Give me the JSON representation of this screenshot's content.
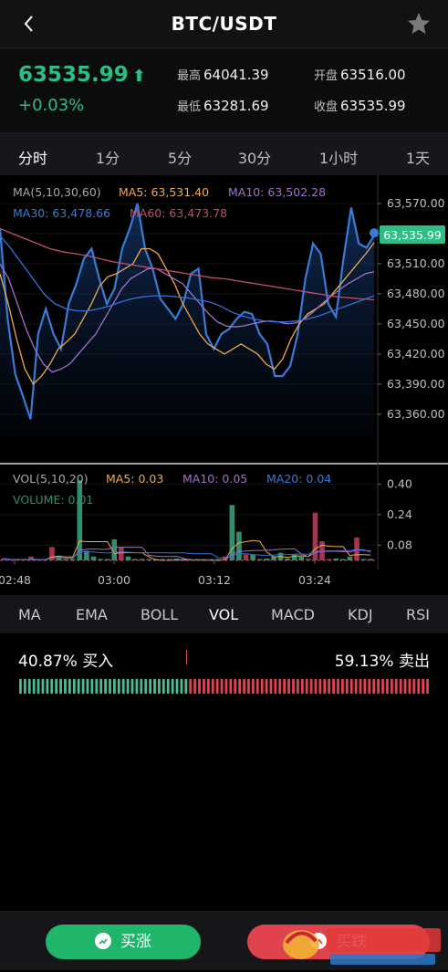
{
  "header": {
    "title": "BTC/USDT",
    "back_icon": "chevron-left-icon",
    "favorite_icon": "star-icon"
  },
  "ticker": {
    "price": "63535.99",
    "change": "+0.03%",
    "high_label": "最高",
    "high": "64041.39",
    "low_label": "最低",
    "low": "63281.69",
    "open_label": "开盘",
    "open": "63516.00",
    "close_label": "收盘",
    "close": "63535.99",
    "up_color": "#2ebd85"
  },
  "timeframes": [
    "分时",
    "1分",
    "5分",
    "30分",
    "1小时",
    "1天"
  ],
  "active_timeframe": "分时",
  "chart_data": {
    "type": "line",
    "main": {
      "legend_line1": {
        "ma": "MA(5,10,30,60)",
        "ma5": "MA5: 63,531.40",
        "ma10": "MA10: 63,502.28"
      },
      "legend_line2": {
        "ma30": "MA30: 63,478.66",
        "ma60": "MA60: 63,473.78"
      },
      "y_ticks": [
        "63,570.00",
        "63,540.00",
        "63,510.00",
        "63,480.00",
        "63,450.00",
        "63,420.00",
        "63,390.00",
        "63,360.00"
      ],
      "ylim": [
        63338,
        63580
      ],
      "last_price_label": "63,535.99",
      "series": [
        {
          "name": "price",
          "color": "#3a7bd5",
          "values": [
            63545,
            63455,
            63400,
            63378,
            63355,
            63440,
            63465,
            63440,
            63425,
            63470,
            63490,
            63515,
            63525,
            63495,
            63470,
            63485,
            63525,
            63545,
            63570,
            63525,
            63505,
            63475,
            63465,
            63455,
            63470,
            63500,
            63505,
            63440,
            63425,
            63440,
            63445,
            63455,
            63462,
            63460,
            63440,
            63430,
            63398,
            63398,
            63408,
            63440,
            63495,
            63530,
            63520,
            63470,
            63457,
            63515,
            63566,
            63530,
            63526,
            63538
          ]
        },
        {
          "name": "MA5",
          "color": "#f0a94b",
          "values": [
            63500,
            63470,
            63435,
            63405,
            63390,
            63398,
            63410,
            63425,
            63432,
            63440,
            63455,
            63470,
            63488,
            63497,
            63500,
            63505,
            63510,
            63525,
            63525,
            63520,
            63505,
            63490,
            63470,
            63455,
            63440,
            63430,
            63425,
            63420,
            63425,
            63430,
            63425,
            63420,
            63410,
            63405,
            63415,
            63435,
            63450,
            63460,
            63465,
            63470,
            63480,
            63490,
            63500,
            63510,
            63520,
            63531
          ]
        },
        {
          "name": "MA10",
          "color": "#a070c8",
          "values": [
            63510,
            63495,
            63470,
            63445,
            63425,
            63410,
            63402,
            63405,
            63410,
            63420,
            63430,
            63440,
            63455,
            63470,
            63485,
            63495,
            63500,
            63505,
            63505,
            63500,
            63495,
            63490,
            63480,
            63470,
            63460,
            63452,
            63448,
            63447,
            63448,
            63450,
            63452,
            63453,
            63452,
            63450,
            63451,
            63455,
            63462,
            63470,
            63477,
            63484,
            63490,
            63495,
            63500,
            63502
          ]
        },
        {
          "name": "MA30",
          "color": "#3a6fd8",
          "values": [
            63538,
            63525,
            63510,
            63495,
            63480,
            63470,
            63465,
            63463,
            63463,
            63465,
            63468,
            63472,
            63475,
            63477,
            63478,
            63478,
            63477,
            63476,
            63474,
            63472,
            63468,
            63462,
            63458,
            63455,
            63453,
            63452,
            63452,
            63453,
            63455,
            63458,
            63462,
            63466,
            63470,
            63474,
            63478
          ]
        },
        {
          "name": "MA60",
          "color": "#c24e6b",
          "values": [
            63545,
            63540,
            63535,
            63530,
            63525,
            63522,
            63520,
            63518,
            63515,
            63512,
            63510,
            63508,
            63506,
            63504,
            63502,
            63500,
            63498,
            63496,
            63495,
            63493,
            63491,
            63489,
            63487,
            63485,
            63483,
            63481,
            63479,
            63477,
            63476,
            63475,
            63474
          ]
        }
      ]
    },
    "volume": {
      "legend": {
        "vol": "VOL(5,10,20)",
        "ma5": "MA5: 0.03",
        "ma10": "MA10: 0.05",
        "ma20": "MA20: 0.04",
        "volume": "VOLUME: 0.01"
      },
      "y_ticks": [
        "0.40",
        "0.24",
        "0.08"
      ],
      "ylim": [
        0,
        0.44
      ],
      "values": [
        0.01,
        0.0,
        0.0,
        0.0,
        0.02,
        0.0,
        0.0,
        0.07,
        0.02,
        0.0,
        0.0,
        0.42,
        0.05,
        0.02,
        0.0,
        0.0,
        0.11,
        0.07,
        0.02,
        0.0,
        0.0,
        0.0,
        0.0,
        0.0,
        0.0,
        0.01,
        0.0,
        0.0,
        0.0,
        0.0,
        0.0,
        0.0,
        0.02,
        0.29,
        0.15,
        0.03,
        0.03,
        0.0,
        0.01,
        0.02,
        0.04,
        0.01,
        0.03,
        0.02,
        0.0,
        0.25,
        0.1,
        0.0,
        0.01,
        0.0,
        0.02,
        0.12,
        0.0,
        0.0
      ],
      "up": [
        0,
        1,
        1,
        1,
        0,
        1,
        1,
        0,
        1,
        1,
        1,
        1,
        1,
        1,
        1,
        1,
        1,
        0,
        1,
        1,
        1,
        1,
        1,
        1,
        1,
        1,
        1,
        1,
        1,
        1,
        1,
        1,
        0,
        1,
        1,
        0,
        1,
        1,
        1,
        1,
        1,
        1,
        1,
        1,
        1,
        0,
        0,
        0,
        1,
        1,
        1,
        0,
        1,
        1
      ]
    },
    "x_ticks": [
      "02:48",
      "03:00",
      "03:12",
      "03:24"
    ],
    "grid": true
  },
  "indicators": [
    "MA",
    "EMA",
    "BOLL",
    "VOL",
    "MACD",
    "KDJ",
    "RSI"
  ],
  "active_indicator": "VOL",
  "depth": {
    "buy_pct": "40.87% 买入",
    "sell_pct": "59.13% 卖出",
    "buy_ratio": 0.4087,
    "buy_color": "#4fb89a",
    "sell_color": "#e0444e"
  },
  "actions": {
    "buy_label": "买涨",
    "sell_label": "买跌"
  }
}
